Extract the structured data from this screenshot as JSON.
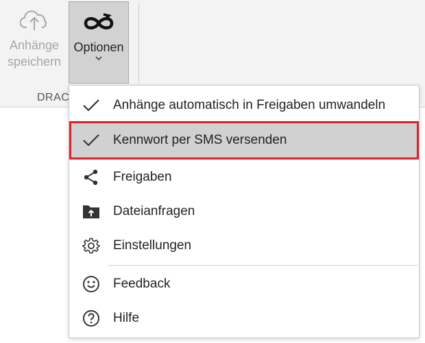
{
  "ribbon": {
    "attachments_button": {
      "line1": "Anhänge",
      "line2": "speichern",
      "icon": "cloud-upload-icon"
    },
    "options_button": {
      "label": "Optionen",
      "icon": "loop-icon"
    },
    "group_label": "DRAC"
  },
  "menu": {
    "items": [
      {
        "label": "Anhänge automatisch in Freigaben umwandeln",
        "icon": "checkmark-icon",
        "checked": true
      },
      {
        "label": "Kennwort per SMS versenden",
        "icon": "checkmark-icon",
        "checked": true,
        "highlighted": true
      },
      {
        "label": "Freigaben",
        "icon": "share-icon"
      },
      {
        "label": "Dateianfragen",
        "icon": "folder-upload-icon"
      },
      {
        "label": "Einstellungen",
        "icon": "gear-icon"
      },
      {
        "label": "Feedback",
        "icon": "smiley-icon"
      },
      {
        "label": "Hilfe",
        "icon": "help-icon"
      }
    ]
  },
  "colors": {
    "highlight_border": "#e0202a",
    "highlight_bg": "#d1d1d1",
    "disabled_text": "#a6a6a6"
  }
}
